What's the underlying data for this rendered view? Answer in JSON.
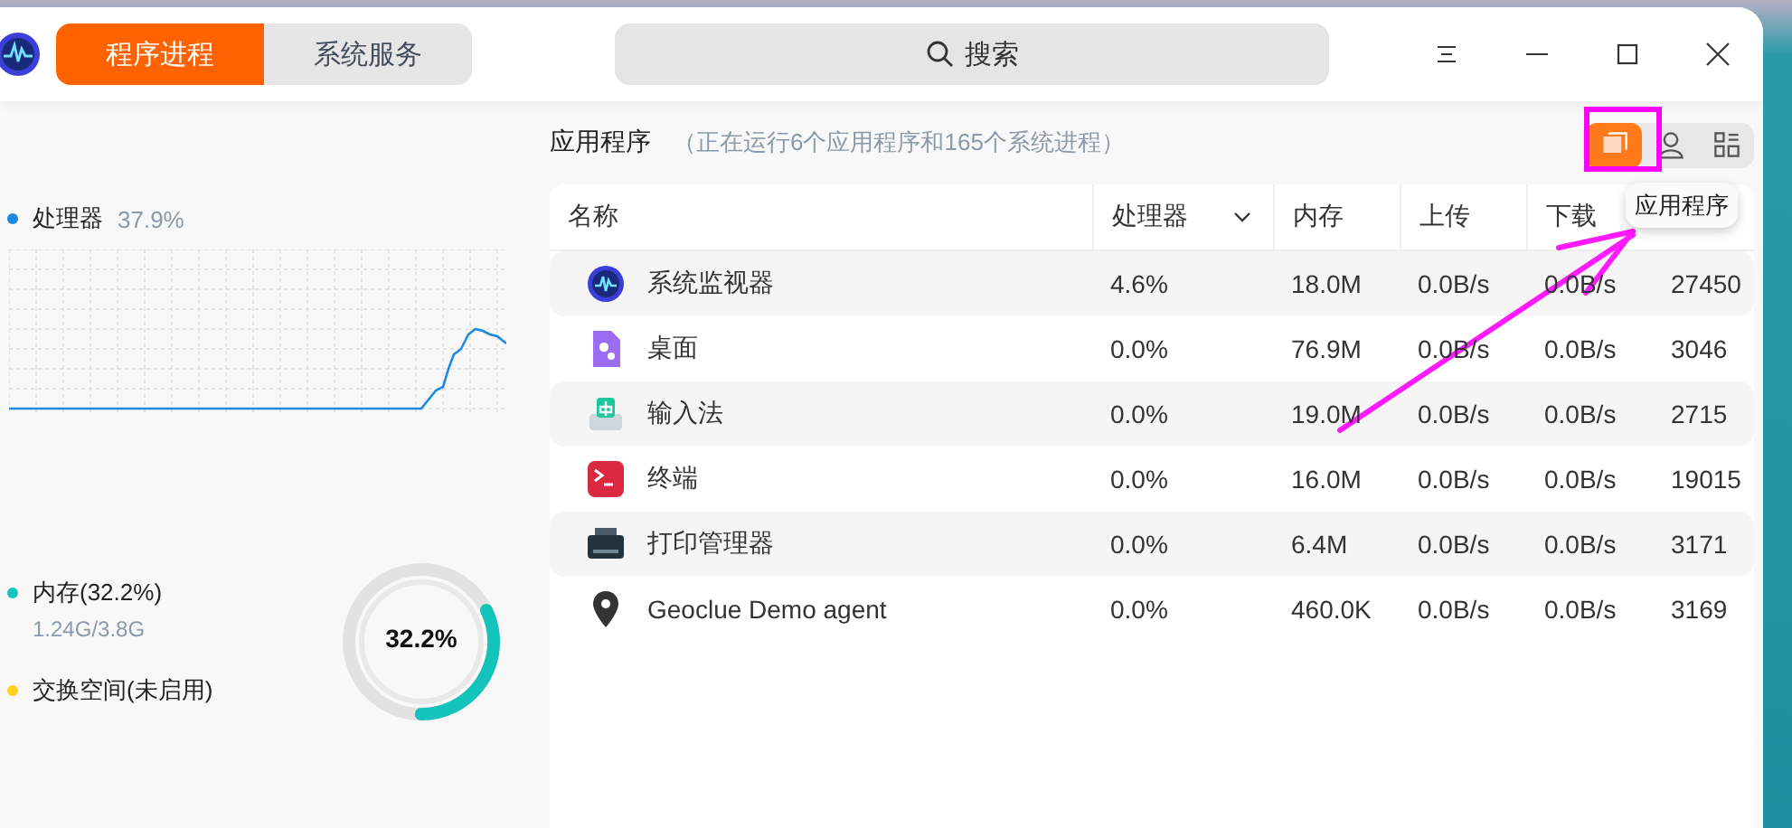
{
  "app": {
    "tabs": [
      {
        "label": "程序进程",
        "selected": true
      },
      {
        "label": "系统服务",
        "selected": false
      }
    ],
    "search": {
      "placeholder": "搜索"
    }
  },
  "sidebar": {
    "items": [
      {
        "kind": "cpu",
        "label": "处理器",
        "value": "37.9%",
        "color": "#1e88e5"
      },
      {
        "kind": "memory",
        "label": "内存(32.2%)",
        "detail": "1.24G/3.8G",
        "color": "#14c3b9"
      },
      {
        "kind": "swap",
        "label": "交换空间(未启用)",
        "color": "#ffd21f"
      }
    ],
    "ring": {
      "label": "32.2%",
      "level": 0.322
    }
  },
  "content": {
    "title": "应用程序",
    "subtitle": "（正在运行6个应用程序和165个系统进程）",
    "view_buttons": [
      {
        "kind": "apps",
        "selected": true
      },
      {
        "kind": "user",
        "selected": false
      },
      {
        "kind": "all",
        "selected": false
      }
    ],
    "tooltip": "应用程序"
  },
  "table": {
    "columns": [
      {
        "label": "名称",
        "sorted": false
      },
      {
        "label": "处理器",
        "sorted": true
      },
      {
        "label": "内存",
        "sorted": false
      },
      {
        "label": "上传",
        "sorted": false
      },
      {
        "label": "下载",
        "sorted": false
      }
    ],
    "rows": [
      {
        "kind": "monitor",
        "cells": [
          "系统监视器",
          "4.6%",
          "18.0M",
          "0.0B/s",
          "0.0B/s",
          "27450"
        ]
      },
      {
        "kind": "desktop",
        "cells": [
          "桌面",
          "0.0%",
          "76.9M",
          "0.0B/s",
          "0.0B/s",
          "3046"
        ]
      },
      {
        "kind": "input",
        "cells": [
          "输入法",
          "0.0%",
          "19.0M",
          "0.0B/s",
          "0.0B/s",
          "2715"
        ]
      },
      {
        "kind": "terminal",
        "cells": [
          "终端",
          "0.0%",
          "16.0M",
          "0.0B/s",
          "0.0B/s",
          "19015"
        ]
      },
      {
        "kind": "printer",
        "cells": [
          "打印管理器",
          "0.0%",
          "6.4M",
          "0.0B/s",
          "0.0B/s",
          "3171"
        ]
      },
      {
        "kind": "location",
        "cells": [
          "Geoclue Demo agent",
          "0.0%",
          "460.0K",
          "0.0B/s",
          "0.0B/s",
          "3169"
        ]
      }
    ]
  }
}
